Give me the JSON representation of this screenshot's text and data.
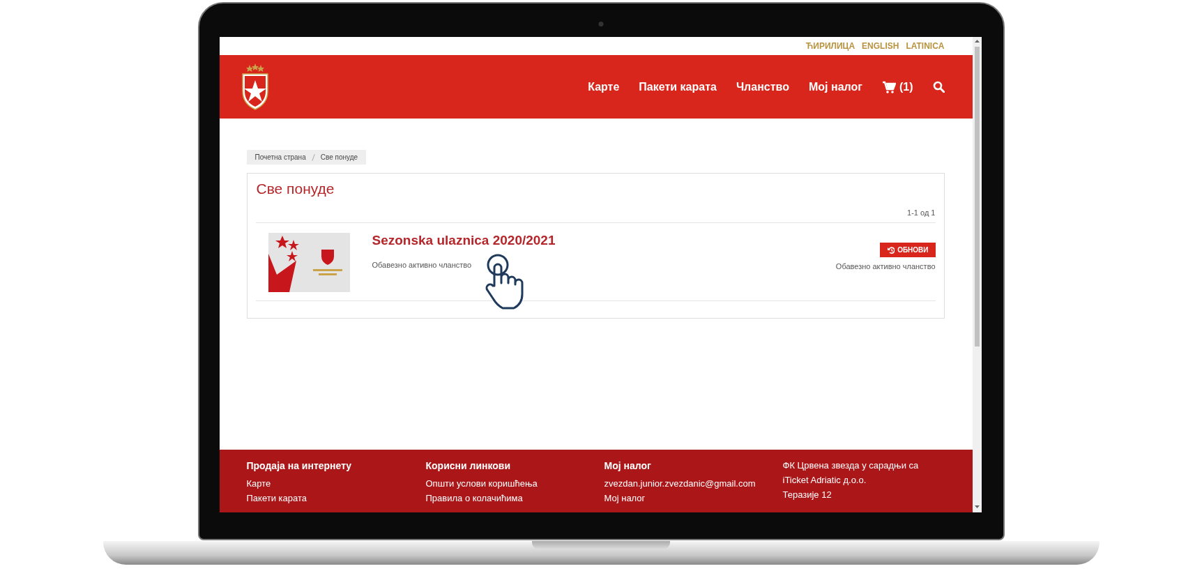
{
  "languages": [
    {
      "label": "ЋИРИЛИЦА"
    },
    {
      "label": "ENGLISH"
    },
    {
      "label": "LATINICA"
    }
  ],
  "nav": [
    {
      "label": "Карте"
    },
    {
      "label": "Пакети карата"
    },
    {
      "label": "Чланство"
    },
    {
      "label": "Мој налог"
    }
  ],
  "cart": {
    "count": "(1)"
  },
  "breadcrumb": [
    "Почетна страна",
    "Све понуде"
  ],
  "page_title": "Све понуде",
  "pagination": "1-1 од 1",
  "offers": [
    {
      "title": "Sezonska ulaznica 2020/2021",
      "note": "Обавезно активно чланство",
      "button": "ОБНОВИ",
      "requirement": "Обавезно активно чланство"
    }
  ],
  "footer": [
    {
      "heading": "Продаја на интернету",
      "lines": [
        "Карте",
        "Пакети карата"
      ]
    },
    {
      "heading": "Корисни линкови",
      "lines": [
        "Општи услови коришћења",
        "Правила о колачићима"
      ]
    },
    {
      "heading": "Мој налог",
      "lines": [
        "zvezdan.junior.zvezdanic@gmail.com",
        "Мој налог"
      ]
    },
    {
      "heading": "ФК Црвена звезда у сарадњи са",
      "lines": [
        "iTicket Adriatic д.о.о.",
        "Теразије 12"
      ]
    }
  ]
}
